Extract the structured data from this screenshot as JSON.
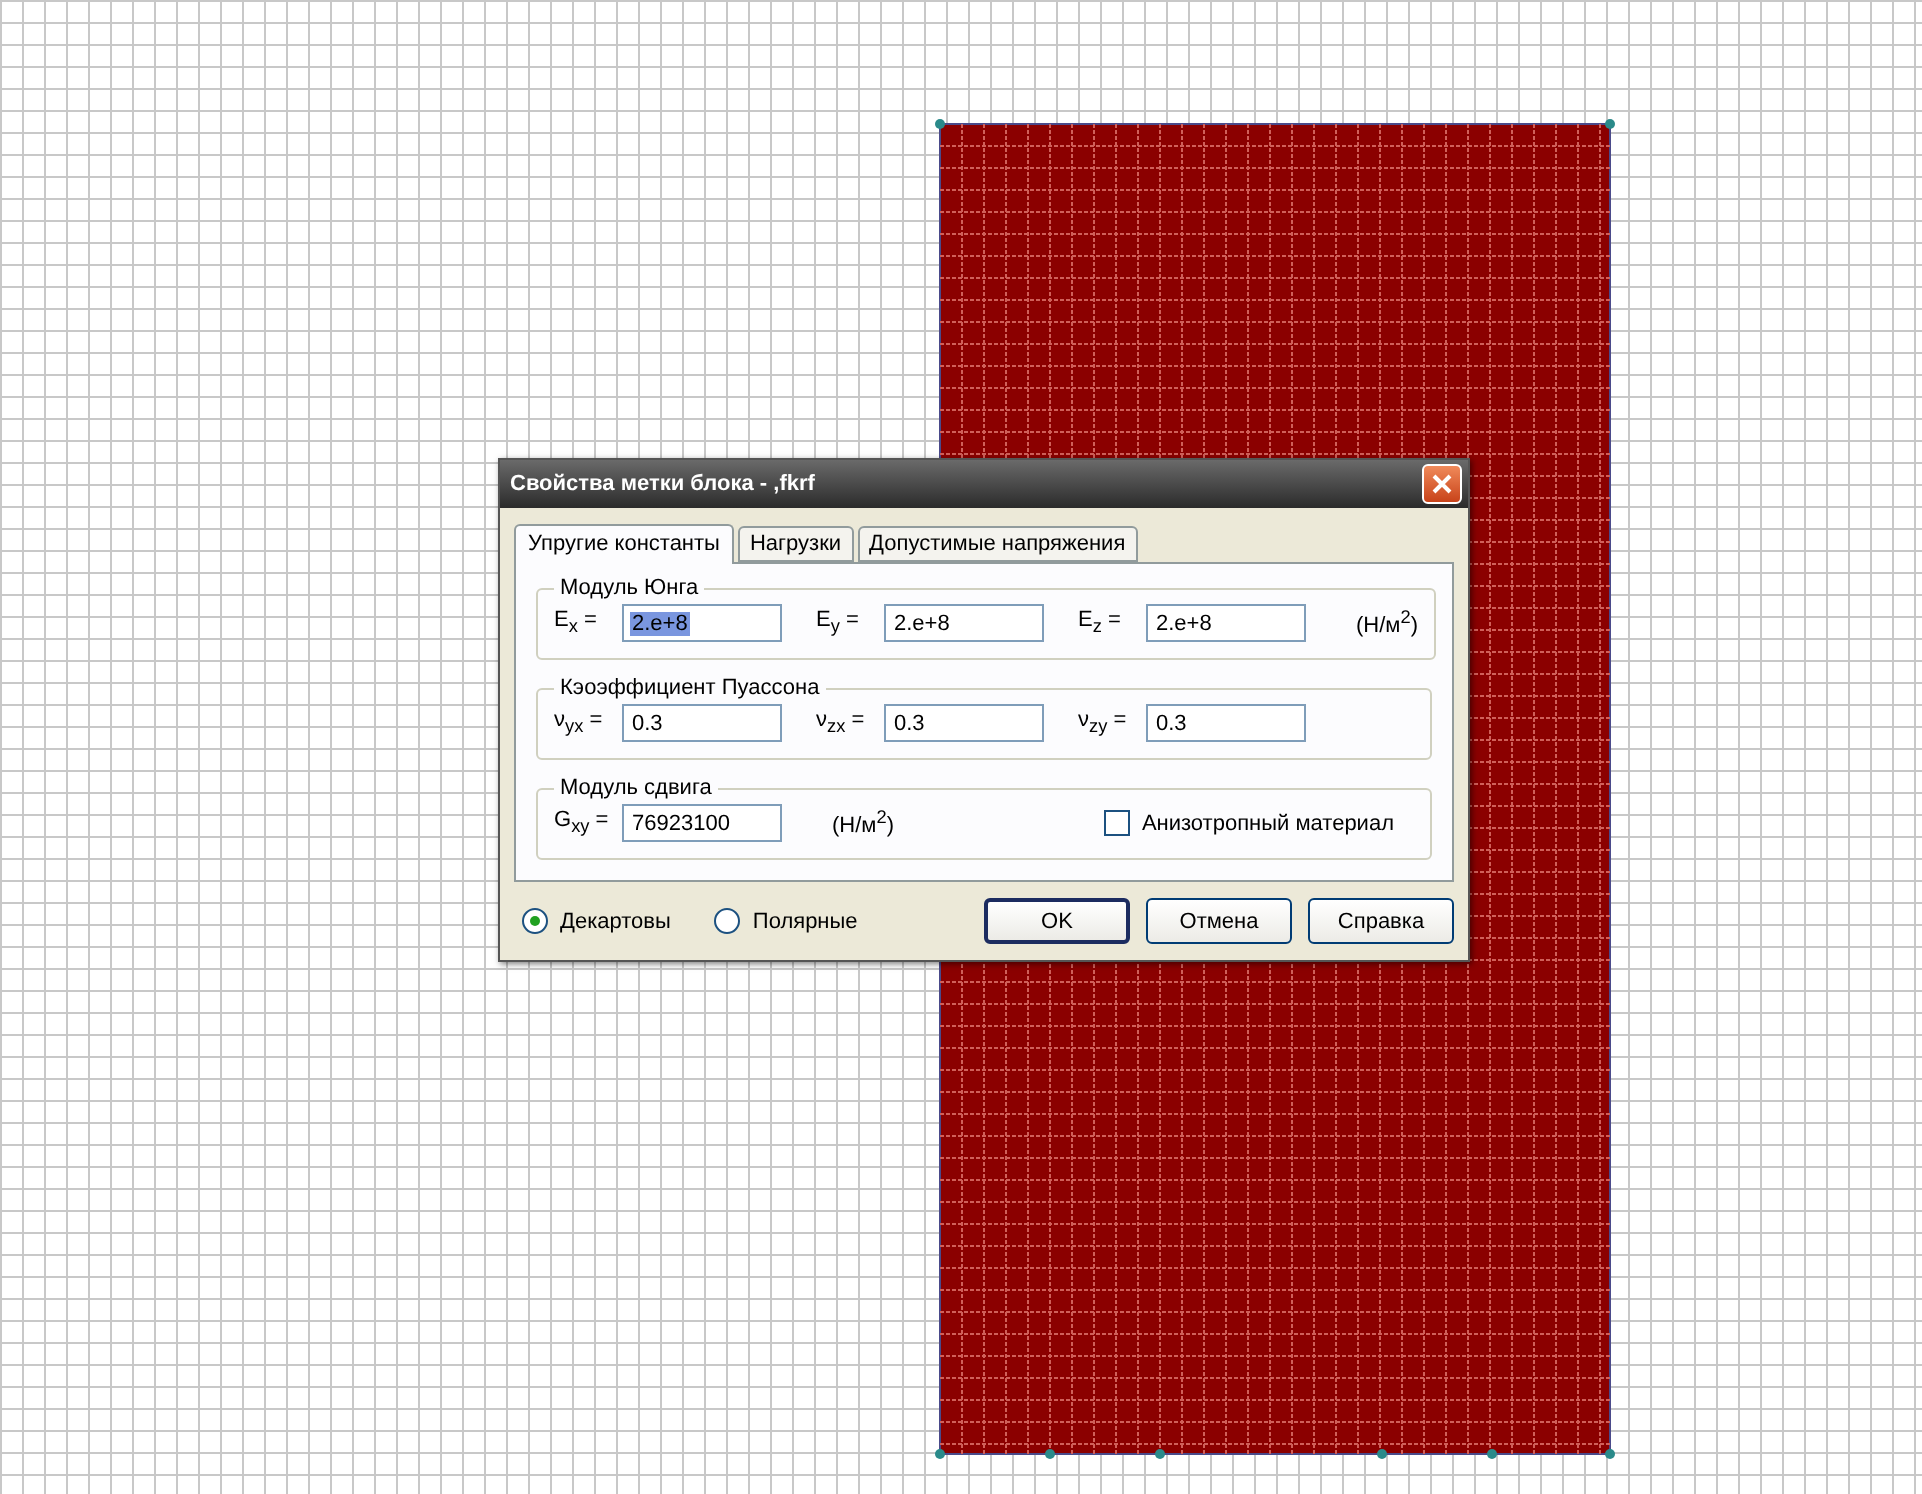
{
  "window": {
    "title": "Свойства метки блока - ,fkrf"
  },
  "tabs": [
    {
      "label": "Упругие константы",
      "selected": true
    },
    {
      "label": "Нагрузки",
      "selected": false
    },
    {
      "label": "Допустимые напряжения",
      "selected": false
    }
  ],
  "groups": [
    {
      "title": "Модуль Юнга",
      "unit": "(Н/м$^{2}$)",
      "fields": [
        {
          "label": "E$_{x}$ =",
          "value": "2.e+8",
          "text_selected": true
        },
        {
          "label": "E$_{y}$ =",
          "value": "2.e+8",
          "text_selected": false
        },
        {
          "label": "E$_{z}$ =",
          "value": "2.e+8",
          "text_selected": false
        }
      ]
    },
    {
      "title": "Кэоэффициент Пуассона",
      "fields": [
        {
          "label": "ν$_{yx}$ =",
          "value": "0.3",
          "text_selected": false
        },
        {
          "label": "ν$_{zx}$ =",
          "value": "0.3",
          "text_selected": false
        },
        {
          "label": "ν$_{zy}$ =",
          "value": "0.3",
          "text_selected": false
        }
      ]
    },
    {
      "title": "Модуль сдвига",
      "unit": "(Н/м$^{2}$)",
      "fields": [
        {
          "label": "G$_{xy}$ =",
          "value": "76923100",
          "text_selected": false
        }
      ],
      "checkbox": {
        "label": "Анизотропный материал",
        "checked": false
      }
    }
  ],
  "radios": [
    {
      "label": "Декартовы",
      "selected": true
    },
    {
      "label": "Полярные",
      "selected": false
    }
  ],
  "buttons": [
    {
      "label": "OK",
      "default": true
    },
    {
      "label": "Отмена",
      "default": false
    },
    {
      "label": "Справка",
      "default": false
    }
  ]
}
